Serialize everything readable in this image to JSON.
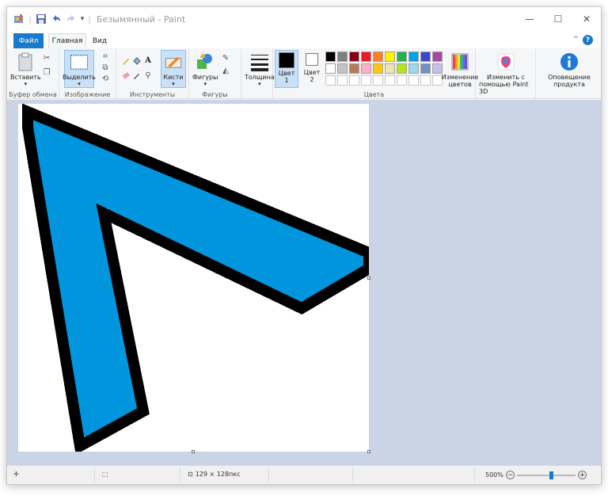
{
  "window": {
    "title": "Безымянный - Paint",
    "minimize_glyph": "—",
    "maximize_glyph": "☐",
    "close_glyph": "✕"
  },
  "tabs": {
    "file": "Файл",
    "home": "Главная",
    "view": "Вид",
    "collapse_glyph": "^",
    "help_glyph": "?"
  },
  "ribbon": {
    "clipboard": {
      "group_label": "Буфер обмена",
      "paste_label": "Вставить"
    },
    "image": {
      "group_label": "Изображение",
      "select_label": "Выделить"
    },
    "tools": {
      "group_label": "Инструменты",
      "brushes_label": "Кисти",
      "text_glyph": "A"
    },
    "shapes": {
      "group_label": "Фигуры",
      "shapes_label": "Фигуры"
    },
    "size": {
      "label": "Толщина"
    },
    "colors": {
      "group_label": "Цвета",
      "color1_label": "Цвет",
      "color1_num": "1",
      "color2_label": "Цвет",
      "color2_num": "2",
      "edit_colors_line1": "Изменение",
      "edit_colors_line2": "цветов",
      "color1_value": "#000000",
      "color2_value": "#ffffff",
      "palette_row1": [
        "#000000",
        "#7f7f7f",
        "#880015",
        "#ed1c24",
        "#ff7f27",
        "#fff200",
        "#22b14c",
        "#00a2e8",
        "#3f48cc",
        "#a349a4"
      ],
      "palette_row2": [
        "#ffffff",
        "#c3c3c3",
        "#b97a57",
        "#ffaec9",
        "#ffc90e",
        "#efe4b0",
        "#b5e61d",
        "#99d9ea",
        "#7092be",
        "#c8bfe7"
      ],
      "palette_row3": [
        "#ffffff",
        "#ffffff",
        "#ffffff",
        "#ffffff",
        "#ffffff",
        "#ffffff",
        "#ffffff",
        "#ffffff",
        "#ffffff",
        "#ffffff"
      ]
    },
    "paint3d": {
      "line1": "Изменить с",
      "line2": "помощью Paint 3D"
    },
    "notify": {
      "line1": "Оповещение",
      "line2": "продукта"
    }
  },
  "canvas": {
    "fill_color": "#0095dd",
    "outline_color": "#000000"
  },
  "status": {
    "size_text": "129 × 128пкс",
    "zoom_text": "500%",
    "zoom_fraction": 0.6,
    "minus_glyph": "−",
    "plus_glyph": "+"
  }
}
